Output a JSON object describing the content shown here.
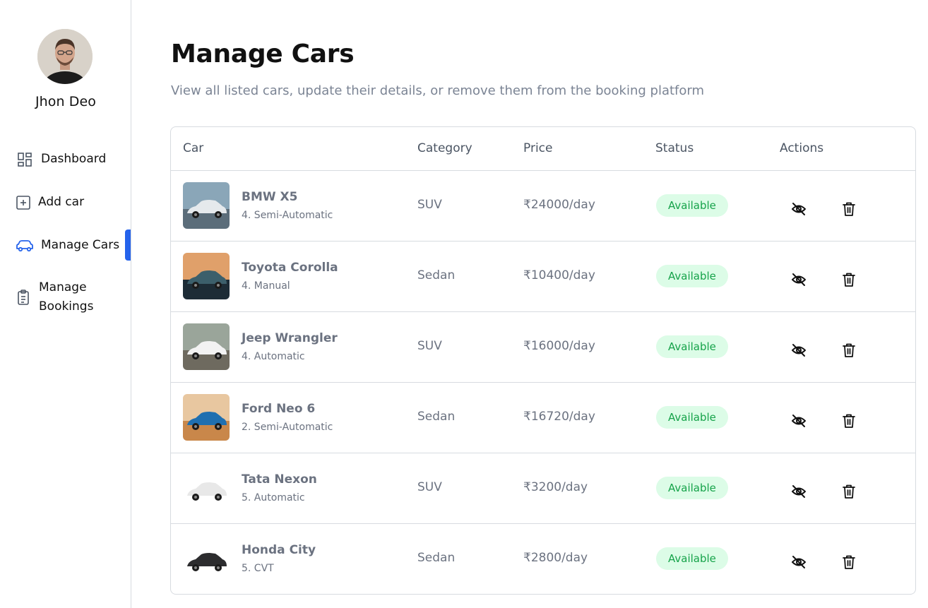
{
  "user": {
    "name": "Jhon Deo"
  },
  "nav": [
    {
      "label": "Dashboard",
      "icon": "dashboard-icon"
    },
    {
      "label": "Add car",
      "icon": "add-square-icon"
    },
    {
      "label": "Manage Cars",
      "icon": "car-icon",
      "active": true
    },
    {
      "label": "Manage\nBookings",
      "icon": "clipboard-list-icon"
    }
  ],
  "page": {
    "title": "Manage Cars",
    "subtitle": "View all listed cars, update their details, or remove them from the booking platform"
  },
  "table": {
    "headers": [
      "Car",
      "Category",
      "Price",
      "Status",
      "Actions"
    ],
    "rows": [
      {
        "name": "BMW X5",
        "sub": "4. Semi-Automatic",
        "category": "SUV",
        "price": "₹24000/day",
        "status": "Available"
      },
      {
        "name": "Toyota Corolla",
        "sub": "4. Manual",
        "category": "Sedan",
        "price": "₹10400/day",
        "status": "Available"
      },
      {
        "name": "Jeep Wrangler",
        "sub": "4. Automatic",
        "category": "SUV",
        "price": "₹16000/day",
        "status": "Available"
      },
      {
        "name": "Ford Neo 6",
        "sub": "2. Semi-Automatic",
        "category": "Sedan",
        "price": "₹16720/day",
        "status": "Available"
      },
      {
        "name": "Tata Nexon",
        "sub": "5. Automatic",
        "category": "SUV",
        "price": "₹3200/day",
        "status": "Available"
      },
      {
        "name": "Honda City",
        "sub": "5. CVT",
        "category": "Sedan",
        "price": "₹2800/day",
        "status": "Available"
      }
    ]
  },
  "colors": {
    "accent": "#2563eb",
    "badge_bg": "#dcfce7",
    "badge_text": "#16a34a",
    "border": "#d7dbe0",
    "muted_text": "#6b7280"
  }
}
